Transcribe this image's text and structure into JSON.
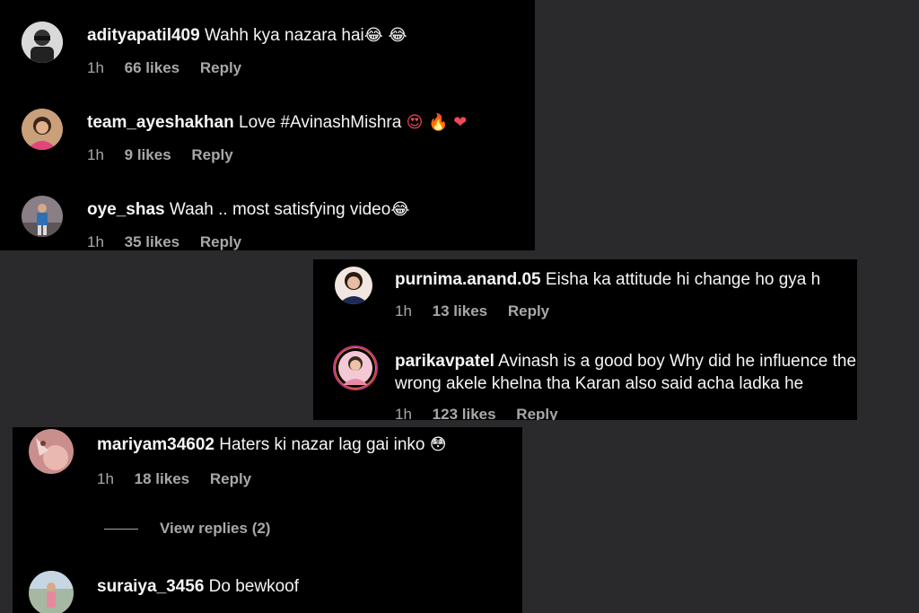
{
  "colors": {
    "background": "#2a2a2c",
    "panel": "#000000",
    "text": "#f5f5f5",
    "meta": "#a8a8a8",
    "heart": "#ed4956"
  },
  "panel1": {
    "comments": [
      {
        "username": "adityapatil409",
        "text": "Wahh kya nazara hai",
        "emoji": "😂 😂",
        "time": "1h",
        "likes": "66 likes",
        "reply": "Reply"
      },
      {
        "username": "team_ayeshakhan",
        "text": "Love #AvinashMishra",
        "emoji": "😍 🔥 ❤",
        "time": "1h",
        "likes": "9 likes",
        "reply": "Reply"
      },
      {
        "username": "oye_shas",
        "text": "Waah .. most satisfying video",
        "emoji": "😂",
        "time": "1h",
        "likes": "35 likes",
        "reply": "Reply"
      }
    ]
  },
  "panel2": {
    "comments": [
      {
        "username": "purnima.anand.05",
        "text": "Eisha ka attitude hi change ho gya h",
        "time": "1h",
        "likes": "13 likes",
        "reply": "Reply"
      },
      {
        "username": "parikavpatel",
        "text": "Avinash is a good boy Why did he influence the",
        "text2": "wrong akele khelna tha Karan also said acha ladka he",
        "time": "1h",
        "likes": "123 likes",
        "reply": "Reply"
      }
    ]
  },
  "panel3": {
    "comments": [
      {
        "username": "mariyam34602",
        "text": "Haters ki nazar lag gai inko",
        "emoji": "😳",
        "time": "1h",
        "likes": "18 likes",
        "reply": "Reply",
        "view_replies": "View replies (2)"
      },
      {
        "username": "suraiya_3456",
        "text": "Do bewkoof"
      }
    ]
  }
}
